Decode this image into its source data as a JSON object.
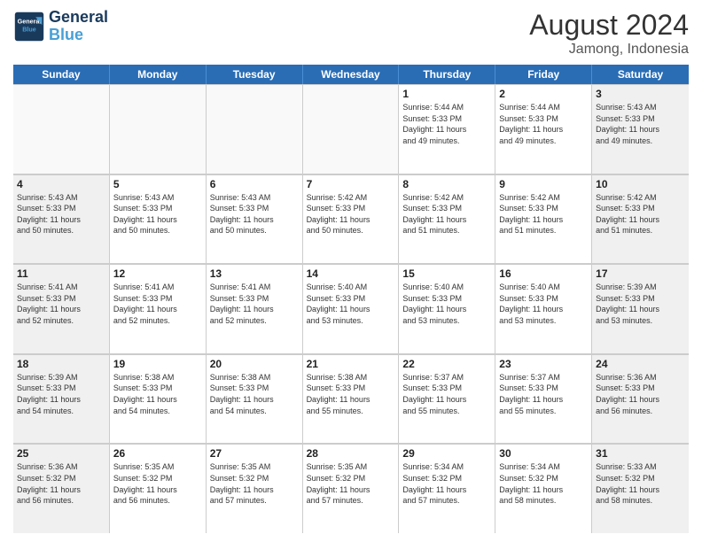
{
  "header": {
    "logo_line1": "General",
    "logo_line2": "Blue",
    "month_title": "August 2024",
    "location": "Jamong, Indonesia"
  },
  "days_of_week": [
    "Sunday",
    "Monday",
    "Tuesday",
    "Wednesday",
    "Thursday",
    "Friday",
    "Saturday"
  ],
  "weeks": [
    [
      {
        "day": "",
        "info": "",
        "empty": true
      },
      {
        "day": "",
        "info": "",
        "empty": true
      },
      {
        "day": "",
        "info": "",
        "empty": true
      },
      {
        "day": "",
        "info": "",
        "empty": true
      },
      {
        "day": "1",
        "info": "Sunrise: 5:44 AM\nSunset: 5:33 PM\nDaylight: 11 hours\nand 49 minutes."
      },
      {
        "day": "2",
        "info": "Sunrise: 5:44 AM\nSunset: 5:33 PM\nDaylight: 11 hours\nand 49 minutes."
      },
      {
        "day": "3",
        "info": "Sunrise: 5:43 AM\nSunset: 5:33 PM\nDaylight: 11 hours\nand 49 minutes."
      }
    ],
    [
      {
        "day": "4",
        "info": "Sunrise: 5:43 AM\nSunset: 5:33 PM\nDaylight: 11 hours\nand 50 minutes."
      },
      {
        "day": "5",
        "info": "Sunrise: 5:43 AM\nSunset: 5:33 PM\nDaylight: 11 hours\nand 50 minutes."
      },
      {
        "day": "6",
        "info": "Sunrise: 5:43 AM\nSunset: 5:33 PM\nDaylight: 11 hours\nand 50 minutes."
      },
      {
        "day": "7",
        "info": "Sunrise: 5:42 AM\nSunset: 5:33 PM\nDaylight: 11 hours\nand 50 minutes."
      },
      {
        "day": "8",
        "info": "Sunrise: 5:42 AM\nSunset: 5:33 PM\nDaylight: 11 hours\nand 51 minutes."
      },
      {
        "day": "9",
        "info": "Sunrise: 5:42 AM\nSunset: 5:33 PM\nDaylight: 11 hours\nand 51 minutes."
      },
      {
        "day": "10",
        "info": "Sunrise: 5:42 AM\nSunset: 5:33 PM\nDaylight: 11 hours\nand 51 minutes."
      }
    ],
    [
      {
        "day": "11",
        "info": "Sunrise: 5:41 AM\nSunset: 5:33 PM\nDaylight: 11 hours\nand 52 minutes."
      },
      {
        "day": "12",
        "info": "Sunrise: 5:41 AM\nSunset: 5:33 PM\nDaylight: 11 hours\nand 52 minutes."
      },
      {
        "day": "13",
        "info": "Sunrise: 5:41 AM\nSunset: 5:33 PM\nDaylight: 11 hours\nand 52 minutes."
      },
      {
        "day": "14",
        "info": "Sunrise: 5:40 AM\nSunset: 5:33 PM\nDaylight: 11 hours\nand 53 minutes."
      },
      {
        "day": "15",
        "info": "Sunrise: 5:40 AM\nSunset: 5:33 PM\nDaylight: 11 hours\nand 53 minutes."
      },
      {
        "day": "16",
        "info": "Sunrise: 5:40 AM\nSunset: 5:33 PM\nDaylight: 11 hours\nand 53 minutes."
      },
      {
        "day": "17",
        "info": "Sunrise: 5:39 AM\nSunset: 5:33 PM\nDaylight: 11 hours\nand 53 minutes."
      }
    ],
    [
      {
        "day": "18",
        "info": "Sunrise: 5:39 AM\nSunset: 5:33 PM\nDaylight: 11 hours\nand 54 minutes."
      },
      {
        "day": "19",
        "info": "Sunrise: 5:38 AM\nSunset: 5:33 PM\nDaylight: 11 hours\nand 54 minutes."
      },
      {
        "day": "20",
        "info": "Sunrise: 5:38 AM\nSunset: 5:33 PM\nDaylight: 11 hours\nand 54 minutes."
      },
      {
        "day": "21",
        "info": "Sunrise: 5:38 AM\nSunset: 5:33 PM\nDaylight: 11 hours\nand 55 minutes."
      },
      {
        "day": "22",
        "info": "Sunrise: 5:37 AM\nSunset: 5:33 PM\nDaylight: 11 hours\nand 55 minutes."
      },
      {
        "day": "23",
        "info": "Sunrise: 5:37 AM\nSunset: 5:33 PM\nDaylight: 11 hours\nand 55 minutes."
      },
      {
        "day": "24",
        "info": "Sunrise: 5:36 AM\nSunset: 5:33 PM\nDaylight: 11 hours\nand 56 minutes."
      }
    ],
    [
      {
        "day": "25",
        "info": "Sunrise: 5:36 AM\nSunset: 5:32 PM\nDaylight: 11 hours\nand 56 minutes."
      },
      {
        "day": "26",
        "info": "Sunrise: 5:35 AM\nSunset: 5:32 PM\nDaylight: 11 hours\nand 56 minutes."
      },
      {
        "day": "27",
        "info": "Sunrise: 5:35 AM\nSunset: 5:32 PM\nDaylight: 11 hours\nand 57 minutes."
      },
      {
        "day": "28",
        "info": "Sunrise: 5:35 AM\nSunset: 5:32 PM\nDaylight: 11 hours\nand 57 minutes."
      },
      {
        "day": "29",
        "info": "Sunrise: 5:34 AM\nSunset: 5:32 PM\nDaylight: 11 hours\nand 57 minutes."
      },
      {
        "day": "30",
        "info": "Sunrise: 5:34 AM\nSunset: 5:32 PM\nDaylight: 11 hours\nand 58 minutes."
      },
      {
        "day": "31",
        "info": "Sunrise: 5:33 AM\nSunset: 5:32 PM\nDaylight: 11 hours\nand 58 minutes."
      }
    ]
  ]
}
